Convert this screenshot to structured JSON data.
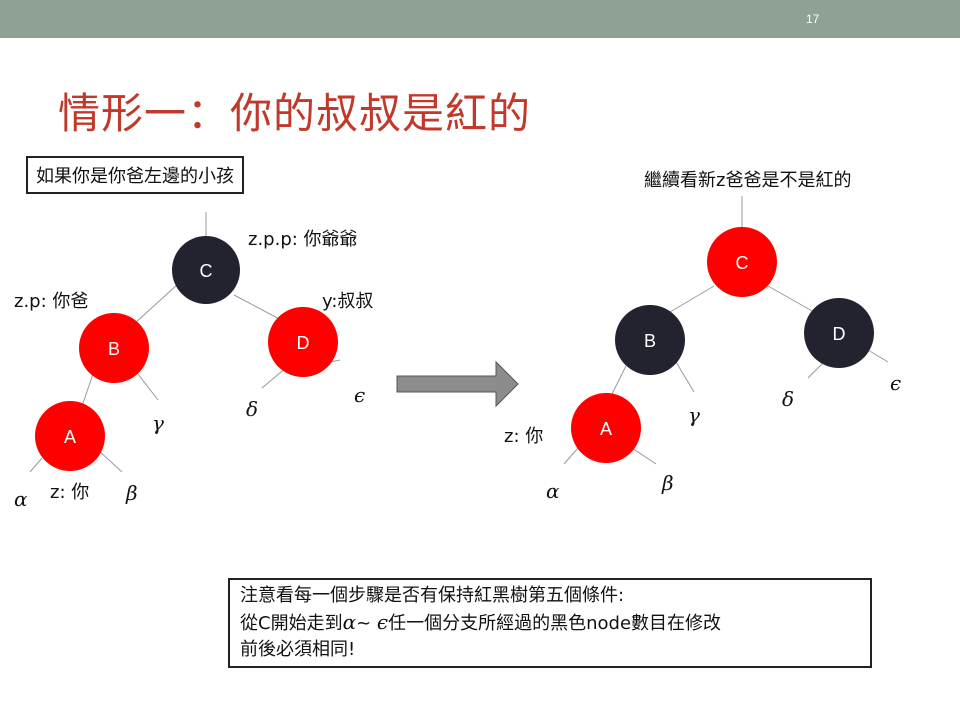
{
  "slide_number": "17",
  "title": "情形一：你的叔叔是紅的",
  "left_tree": {
    "note": "如果你是你爸左邊的小孩",
    "nodes": {
      "c": {
        "label": "C",
        "color": "#23232f",
        "role": "z.p.p: 你爺爺"
      },
      "b": {
        "label": "B",
        "color": "#ff0000",
        "role": "z.p: 你爸"
      },
      "d": {
        "label": "D",
        "color": "#ff0000",
        "role": "y:叔叔"
      },
      "a": {
        "label": "A",
        "color": "#ff0000",
        "role": "z: 你"
      }
    },
    "leaves": {
      "alpha": "α",
      "beta": "β",
      "gamma": "γ",
      "delta": "δ",
      "epsilon": "ϵ"
    }
  },
  "right_tree": {
    "caption": "繼續看新z爸爸是不是紅的",
    "nodes": {
      "c": {
        "label": "C",
        "color": "#ff0000"
      },
      "b": {
        "label": "B",
        "color": "#23232f"
      },
      "d": {
        "label": "D",
        "color": "#23232f"
      },
      "a": {
        "label": "A",
        "color": "#ff0000",
        "role": "z: 你"
      }
    },
    "leaves": {
      "alpha": "α",
      "beta": "β",
      "gamma": "γ",
      "delta": "δ",
      "epsilon": "ϵ"
    }
  },
  "arrow_color": "#8c8c8c",
  "bottom_note": {
    "line1": "注意看每一個步驟是否有保持紅黑樹第五個條件:",
    "line2_prefix": "從C開始走到",
    "line2_alpha": "α",
    "line2_tilde": "~ ",
    "line2_epsilon": "ϵ",
    "line2_suffix": "任一個分支所經過的黑色node數目在修改",
    "line3": "前後必須相同!"
  }
}
